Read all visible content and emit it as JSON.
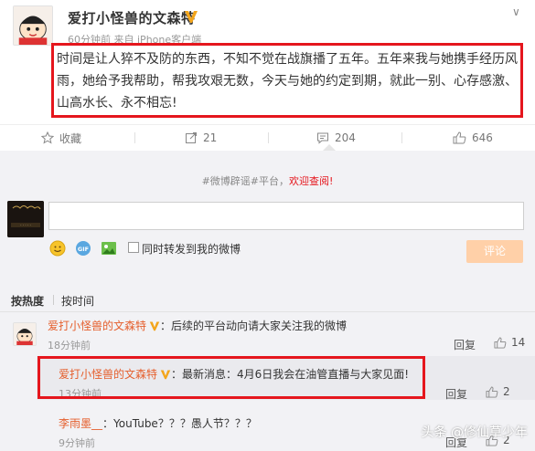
{
  "post": {
    "author": "爱打小怪兽的文森特",
    "time": "60分钟前",
    "source_prefix": "来自",
    "source": "iPhone客户端",
    "text": "时间是让人猝不及防的东西，不知不觉在战旗播了五年。五年来我与她携手经历风雨，她给予我帮助，帮我攻艰无数，今天与她的约定到期，就此一别、心存感激、山高水长、永不相忘!"
  },
  "actions": {
    "favorite": "收藏",
    "repost": "21",
    "comment": "204",
    "like": "646"
  },
  "panel": {
    "topic_prefix": "#微博辟谣#平台，",
    "topic_link": "欢迎查阅!",
    "input_placeholder": "",
    "repost_label": "同时转发到我的微博",
    "submit": "评论",
    "sort_hot": "按热度",
    "sort_time": "按时间"
  },
  "comments": [
    {
      "name": "爱打小怪兽的文森特",
      "text": "：后续的平台动向请大家关注我的微博",
      "time": "18分钟前",
      "reply": "回复",
      "likes": "14"
    },
    {
      "name": "爱打小怪兽的文森特",
      "text": "：最新消息：4月6日我会在油管直播与大家见面!",
      "time": "13分钟前",
      "reply": "回复",
      "likes": "2"
    },
    {
      "name": "李雨墨__",
      "text": "：YouTube？？？愚人节？？？",
      "time": "9分钟前",
      "reply": "回复",
      "likes": "2"
    }
  ],
  "watermark": "头条 @修仙草少年",
  "colors": {
    "accent_red": "#e5161d",
    "name_orange": "#e55e2c",
    "button_disabled": "#ffd0a8",
    "verified_gold": "#f3a51b"
  }
}
